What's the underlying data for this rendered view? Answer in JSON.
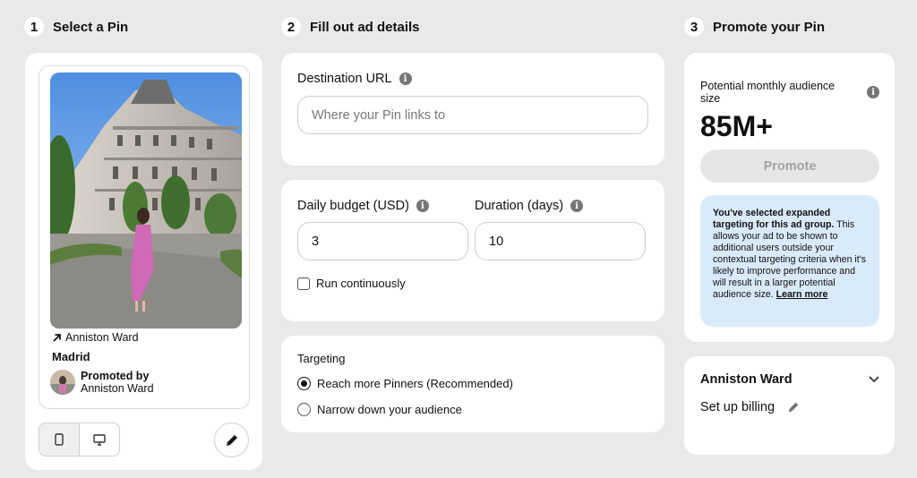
{
  "steps": [
    {
      "num": "1",
      "title": "Select a Pin"
    },
    {
      "num": "2",
      "title": "Fill out ad details"
    },
    {
      "num": "3",
      "title": "Promote your Pin"
    }
  ],
  "pin": {
    "destination": "Anniston Ward",
    "title": "Madrid",
    "promoted_by_label": "Promoted by",
    "promoted_by_name": "Anniston Ward",
    "image_icon": "photo-building-street"
  },
  "device_toggle": {
    "mobile_icon": "phone-icon",
    "desktop_icon": "monitor-icon",
    "selected": "mobile"
  },
  "destination_url": {
    "label": "Destination URL",
    "placeholder": "Where your Pin links to",
    "value": ""
  },
  "budget": {
    "label": "Daily budget (USD)",
    "value": "3"
  },
  "duration": {
    "label": "Duration (days)",
    "value": "10"
  },
  "run_continuously": {
    "label": "Run continuously",
    "checked": false
  },
  "targeting": {
    "label": "Targeting",
    "options": [
      {
        "label": "Reach more Pinners (Recommended)",
        "checked": true
      },
      {
        "label": "Narrow down your audience",
        "checked": false
      }
    ]
  },
  "audience": {
    "label": "Potential monthly audience size",
    "value": "85M+",
    "promote_label": "Promote",
    "notice_bold": "You've selected expanded targeting for this ad group.",
    "notice_text": " This allows your ad to be shown to additional users outside your contextual targeting criteria when it's likely to improve performance and will result in a larger potential audience size. ",
    "learn_more": "Learn more"
  },
  "account": {
    "name": "Anniston Ward",
    "billing_label": "Set up billing"
  },
  "colors": {
    "background": "#e9e9e9",
    "card": "#ffffff",
    "notice_bg": "#d9ebfb",
    "button_disabled": "#e6e6e6"
  }
}
